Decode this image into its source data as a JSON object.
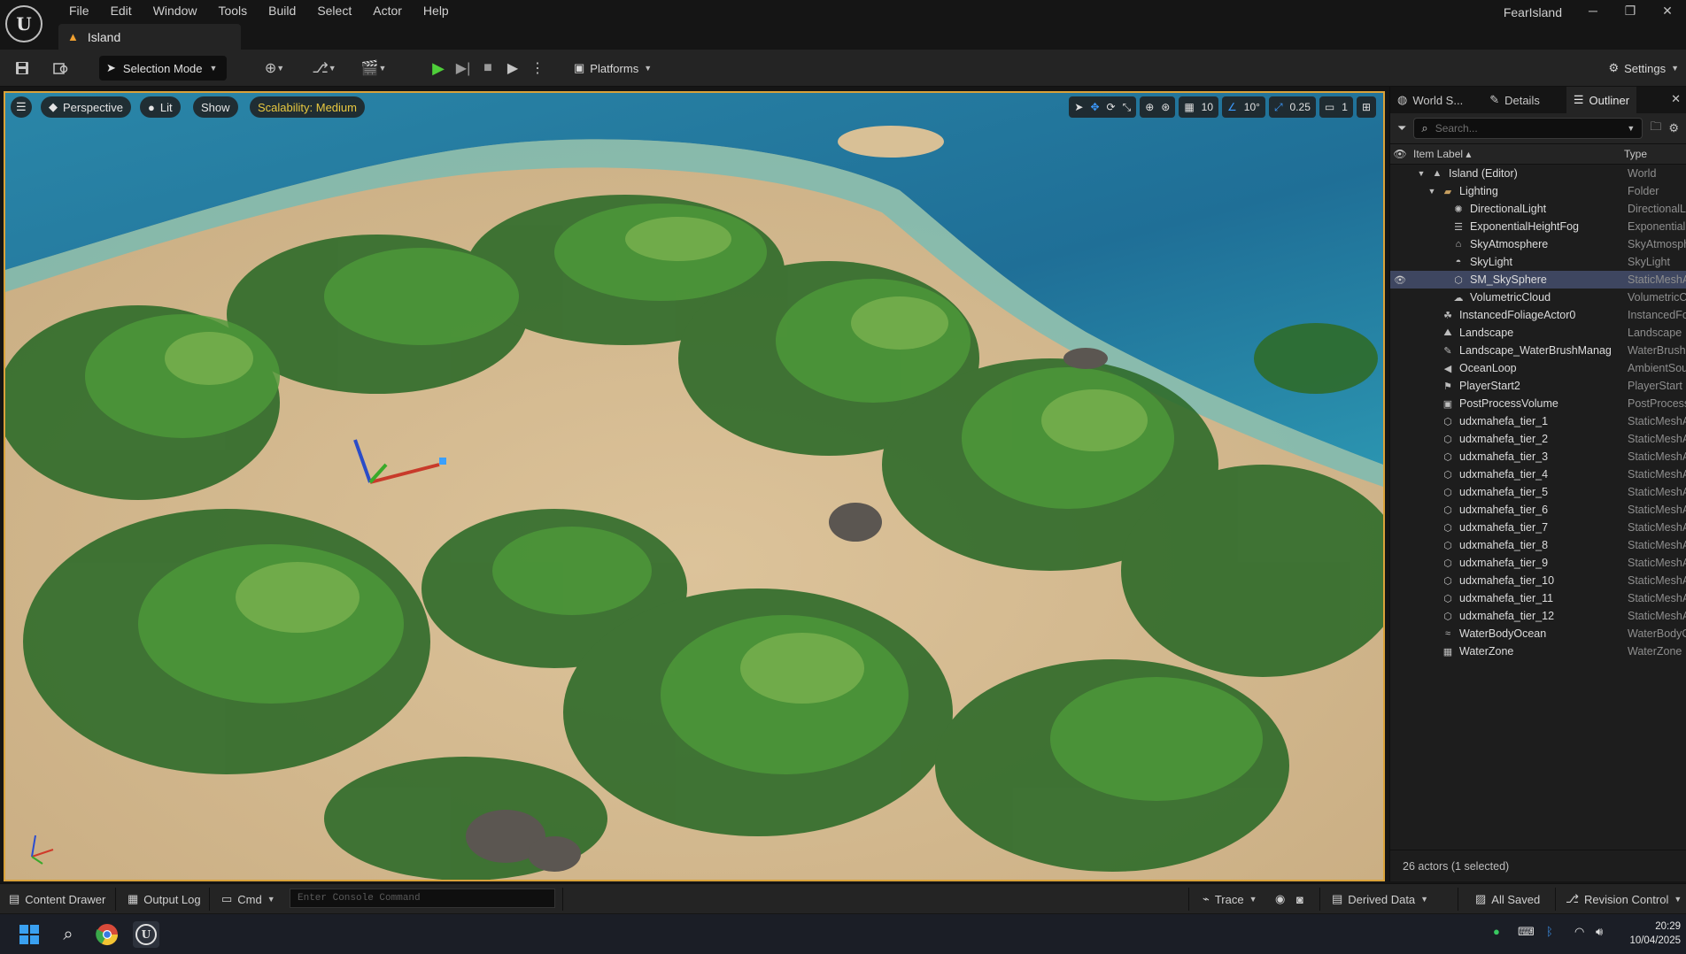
{
  "app": {
    "project_name": "FearIsland",
    "level_tab": "Island",
    "menu": [
      "File",
      "Edit",
      "Window",
      "Tools",
      "Build",
      "Select",
      "Actor",
      "Help"
    ]
  },
  "toolbar": {
    "selection_mode": "Selection Mode",
    "platforms": "Platforms",
    "settings": "Settings"
  },
  "viewport": {
    "perspective": "Perspective",
    "lit": "Lit",
    "show": "Show",
    "scalability": "Scalability: Medium",
    "grid_snap": "10",
    "rotation_snap": "10°",
    "scale_snap": "0.25",
    "camera_speed": "1"
  },
  "panel": {
    "tabs": [
      "World S...",
      "Details",
      "Outliner"
    ],
    "search_placeholder": "Search...",
    "col_label": "Item Label ▴",
    "col_type": "Type",
    "items": [
      {
        "name": "Island (Editor)",
        "type": "World",
        "depth": 0,
        "icon": "world-icon",
        "arrow": "▼"
      },
      {
        "name": "Lighting",
        "type": "Folder",
        "depth": 1,
        "icon": "folder-icon",
        "arrow": "▼"
      },
      {
        "name": "DirectionalLight",
        "type": "DirectionalLi",
        "depth": 2,
        "icon": "sun-icon"
      },
      {
        "name": "ExponentialHeightFog",
        "type": "ExponentialH",
        "depth": 2,
        "icon": "fog-icon"
      },
      {
        "name": "SkyAtmosphere",
        "type": "SkyAtmosph",
        "depth": 2,
        "icon": "sky-atmosphere-icon"
      },
      {
        "name": "SkyLight",
        "type": "SkyLight",
        "depth": 2,
        "icon": "skylight-icon"
      },
      {
        "name": "SM_SkySphere",
        "type": "StaticMeshA",
        "depth": 2,
        "icon": "static-mesh-icon",
        "selected": true
      },
      {
        "name": "VolumetricCloud",
        "type": "VolumetricC",
        "depth": 2,
        "icon": "cloud-icon"
      },
      {
        "name": "InstancedFoliageActor0",
        "type": "InstancedFo",
        "depth": 1,
        "icon": "foliage-icon"
      },
      {
        "name": "Landscape",
        "type": "Landscape",
        "depth": 1,
        "icon": "landscape-icon"
      },
      {
        "name": "Landscape_WaterBrushManag",
        "type": "WaterBrushI",
        "depth": 1,
        "icon": "brush-icon"
      },
      {
        "name": "OceanLoop",
        "type": "AmbientSoun",
        "depth": 1,
        "icon": "speaker-icon"
      },
      {
        "name": "PlayerStart2",
        "type": "PlayerStart",
        "depth": 1,
        "icon": "flag-icon"
      },
      {
        "name": "PostProcessVolume",
        "type": "PostProcess",
        "depth": 1,
        "icon": "volume-icon"
      },
      {
        "name": "udxmahefa_tier_1",
        "type": "StaticMeshA",
        "depth": 1,
        "icon": "static-mesh-icon"
      },
      {
        "name": "udxmahefa_tier_2",
        "type": "StaticMeshA",
        "depth": 1,
        "icon": "static-mesh-icon"
      },
      {
        "name": "udxmahefa_tier_3",
        "type": "StaticMeshA",
        "depth": 1,
        "icon": "static-mesh-icon"
      },
      {
        "name": "udxmahefa_tier_4",
        "type": "StaticMeshA",
        "depth": 1,
        "icon": "static-mesh-icon"
      },
      {
        "name": "udxmahefa_tier_5",
        "type": "StaticMeshA",
        "depth": 1,
        "icon": "static-mesh-icon"
      },
      {
        "name": "udxmahefa_tier_6",
        "type": "StaticMeshA",
        "depth": 1,
        "icon": "static-mesh-icon"
      },
      {
        "name": "udxmahefa_tier_7",
        "type": "StaticMeshA",
        "depth": 1,
        "icon": "static-mesh-icon"
      },
      {
        "name": "udxmahefa_tier_8",
        "type": "StaticMeshA",
        "depth": 1,
        "icon": "static-mesh-icon"
      },
      {
        "name": "udxmahefa_tier_9",
        "type": "StaticMeshA",
        "depth": 1,
        "icon": "static-mesh-icon"
      },
      {
        "name": "udxmahefa_tier_10",
        "type": "StaticMeshA",
        "depth": 1,
        "icon": "static-mesh-icon"
      },
      {
        "name": "udxmahefa_tier_11",
        "type": "StaticMeshA",
        "depth": 1,
        "icon": "static-mesh-icon"
      },
      {
        "name": "udxmahefa_tier_12",
        "type": "StaticMeshA",
        "depth": 1,
        "icon": "static-mesh-icon"
      },
      {
        "name": "WaterBodyOcean",
        "type": "WaterBodyO",
        "depth": 1,
        "icon": "water-icon"
      },
      {
        "name": "WaterZone",
        "type": "WaterZone",
        "depth": 1,
        "icon": "water-zone-icon"
      }
    ],
    "status": "26 actors (1 selected)"
  },
  "statusbar": {
    "content_drawer": "Content Drawer",
    "output_log": "Output Log",
    "cmd": "Cmd",
    "console_placeholder": "Enter Console Command",
    "trace": "Trace",
    "derived_data": "Derived Data",
    "all_saved": "All Saved",
    "revision_control": "Revision Control"
  },
  "taskbar": {
    "time": "20:29",
    "date": "10/04/2025"
  },
  "colors": {
    "accent_selection": "#3e4660",
    "viewport_border": "#d9a23a",
    "play_green": "#4fcf3a",
    "scalability_text": "#e8c840"
  }
}
